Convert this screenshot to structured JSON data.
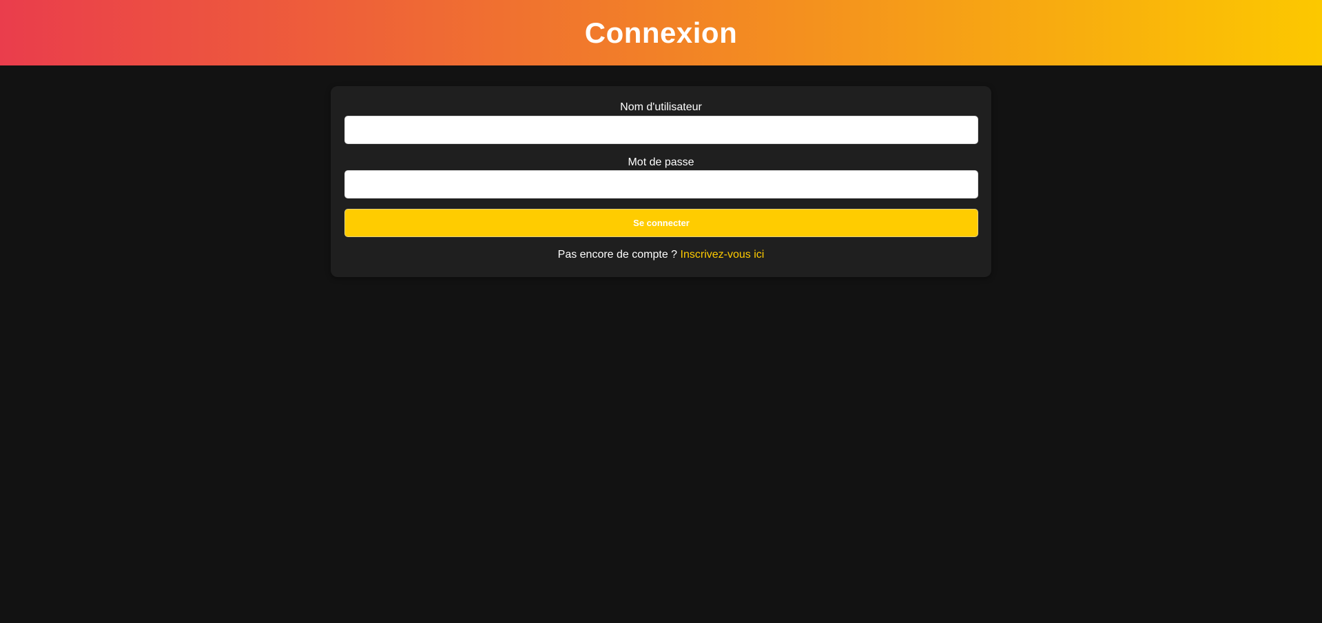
{
  "header": {
    "title": "Connexion"
  },
  "form": {
    "username_label": "Nom d'utilisateur",
    "username_value": "",
    "password_label": "Mot de passe",
    "password_value": "",
    "submit_label": "Se connecter",
    "signup_prompt": "Pas encore de compte ?",
    "signup_link": "Inscrivez-vous ici"
  },
  "colors": {
    "accent": "#ffcc00",
    "background": "#121212",
    "card": "#1f1f1f",
    "gradient_start": "#ea3d4c",
    "gradient_end": "#fcc800"
  }
}
